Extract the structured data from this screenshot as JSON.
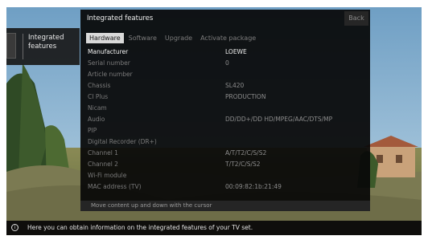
{
  "left_menu": {
    "item_label_line1": "Integrated",
    "item_label_line2": "features"
  },
  "panel": {
    "title": "Integrated features",
    "back_label": "Back",
    "tabs": [
      {
        "label": "Hardware",
        "active": true
      },
      {
        "label": "Software",
        "active": false
      },
      {
        "label": "Upgrade",
        "active": false
      },
      {
        "label": "Activate package",
        "active": false
      }
    ],
    "rows": [
      {
        "label": "Manufacturer",
        "value": "LOEWE"
      },
      {
        "label": "Serial number",
        "value": "0"
      },
      {
        "label": "Article number",
        "value": ""
      },
      {
        "label": "Chassis",
        "value": "SL420"
      },
      {
        "label": "CI Plus",
        "value": "PRODUCTION"
      },
      {
        "label": "Nicam",
        "value": ""
      },
      {
        "label": "Audio",
        "value": "DD/DD+/DD HD/MPEG/AAC/DTS/MP"
      },
      {
        "label": "PIP",
        "value": ""
      },
      {
        "label": "Digital Recorder (DR+)",
        "value": ""
      },
      {
        "label": "Channel 1",
        "value": "A/T/T2/C/S/S2"
      },
      {
        "label": "Channel 2",
        "value": "T/T2/C/S/S2"
      },
      {
        "label": "Wi-Fi module",
        "value": ""
      },
      {
        "label": "MAC address (TV)",
        "value": "00:09:82:1b:21:49"
      }
    ],
    "hint": "Move content up and down with the cursor"
  },
  "info_bar": {
    "icon": "info-icon",
    "text": "Here you can obtain information on the integrated features of your TV set."
  }
}
